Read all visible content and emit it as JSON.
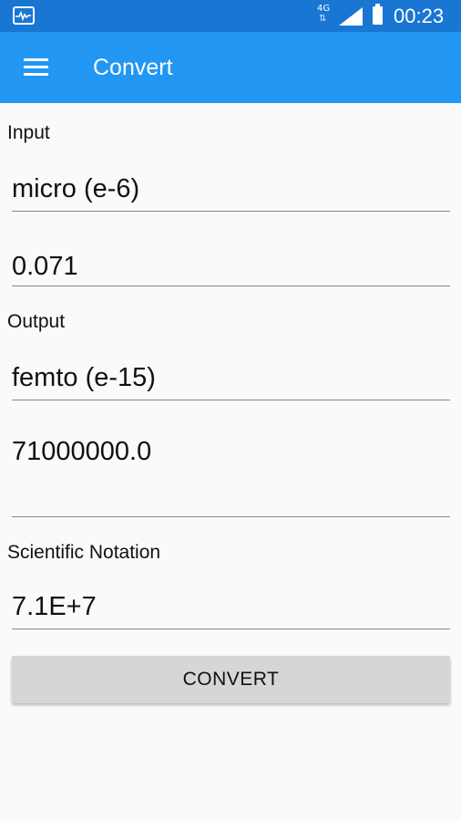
{
  "status_bar": {
    "network": "4G",
    "network_arrows": "⇅",
    "time": "00:23"
  },
  "app_bar": {
    "title": "Convert",
    "menu_icon": "hamburger-menu-icon"
  },
  "input": {
    "label": "Input",
    "prefix": "micro (e-6)",
    "value": "0.071"
  },
  "output": {
    "label": "Output",
    "prefix": "femto (e-15)",
    "value": "71000000.0"
  },
  "scientific": {
    "label": "Scientific Notation",
    "value": "7.1E+7"
  },
  "convert_button": {
    "label": "CONVERT"
  },
  "colors": {
    "status_bar": "#1976d2",
    "app_bar": "#2196f3",
    "background": "#fafafa",
    "button": "#d6d6d6"
  }
}
